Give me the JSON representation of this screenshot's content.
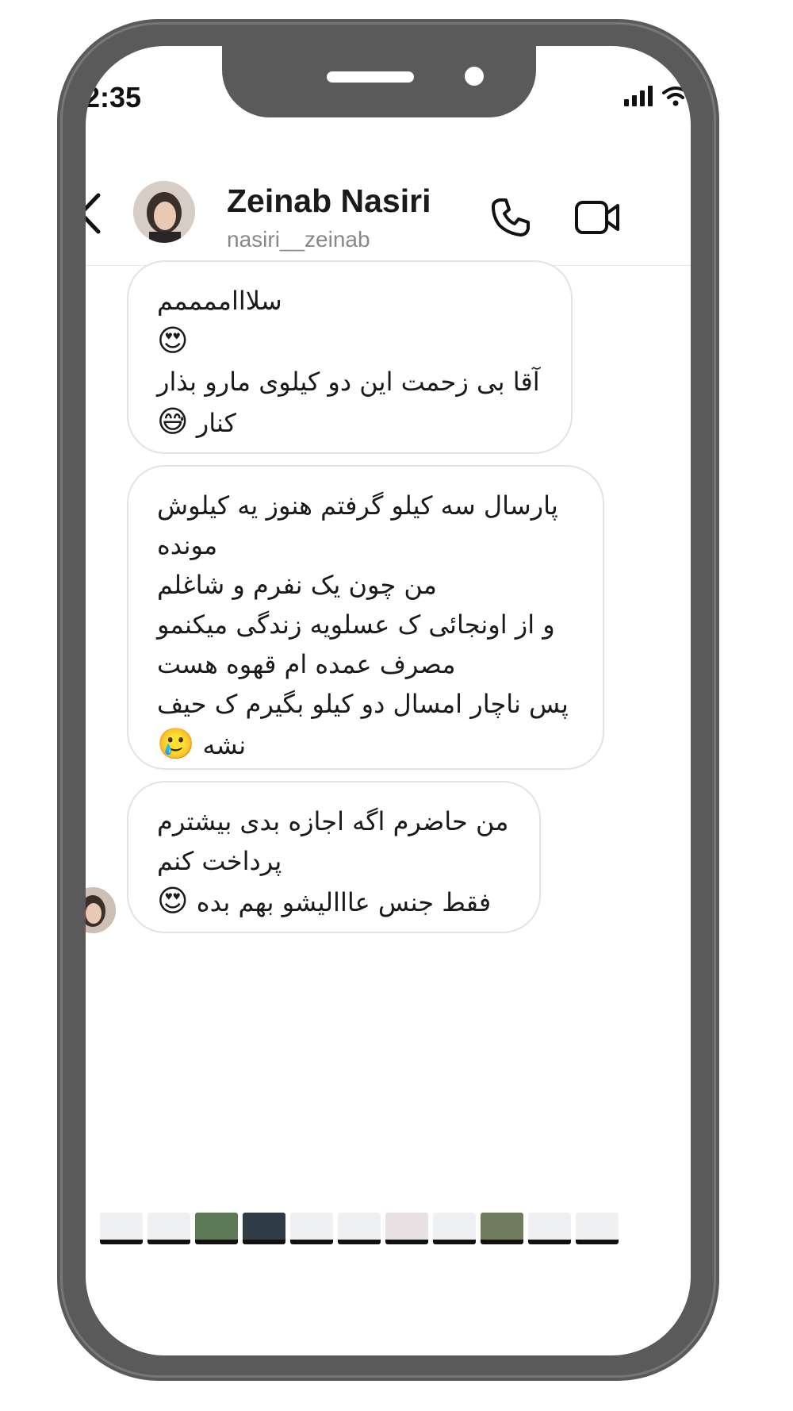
{
  "status_bar": {
    "time": "2:35"
  },
  "header": {
    "contact_name": "Zeinab Nasiri",
    "username": "nasiri__zeinab"
  },
  "messages": [
    {
      "lines": [
        {
          "text": "سلاااممممم",
          "emoji": ""
        },
        {
          "text": "",
          "emoji": "😍"
        },
        {
          "text": "آقا بی زحمت این دو کیلوی مارو بذار",
          "emoji": ""
        },
        {
          "text": "کنار",
          "emoji": "😅"
        }
      ]
    },
    {
      "lines": [
        {
          "text": "پارسال سه کیلو گرفتم هنوز یه کیلوش",
          "emoji": ""
        },
        {
          "text": "مونده",
          "emoji": ""
        },
        {
          "text": "من چون یک نفرم و شاغلم",
          "emoji": ""
        },
        {
          "text": "و از اونجائی ک عسلویه زندگی میکنمو",
          "emoji": ""
        },
        {
          "text": "مصرف عمده ام قهوه هست",
          "emoji": ""
        },
        {
          "text": "پس ناچار امسال دو کیلو بگیرم ک حیف",
          "emoji": ""
        },
        {
          "text": "نشه",
          "emoji": "🥲"
        }
      ]
    },
    {
      "lines": [
        {
          "text": "من حاضرم اگه اجازه بدی بیشترم",
          "emoji": ""
        },
        {
          "text": "پرداخت کنم",
          "emoji": ""
        },
        {
          "text": "فقط جنس عااالیشو بهم بده",
          "emoji": "😍"
        }
      ]
    }
  ],
  "icons": {
    "back": "chevron-left-icon",
    "call": "phone-icon",
    "video": "video-camera-icon",
    "signal": "cellular-signal-icon",
    "wifi": "wifi-icon"
  },
  "colors": {
    "frame": "#5a5a5a",
    "bubble_border": "#e3e3e3",
    "text": "#1a1a1a",
    "username": "#888888"
  }
}
